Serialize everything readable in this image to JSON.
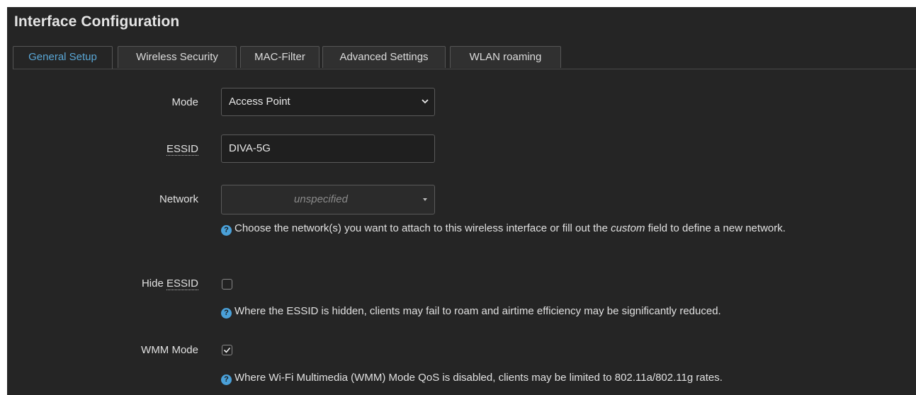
{
  "panel": {
    "title": "Interface Configuration"
  },
  "tabs": [
    {
      "label": "General Setup",
      "active": true
    },
    {
      "label": "Wireless Security",
      "active": false
    },
    {
      "label": "MAC-Filter",
      "active": false
    },
    {
      "label": "Advanced Settings",
      "active": false
    },
    {
      "label": "WLAN roaming",
      "active": false
    }
  ],
  "form": {
    "mode": {
      "label": "Mode",
      "value": "Access Point"
    },
    "essid": {
      "label": "ESSID",
      "value": "DIVA-5G"
    },
    "network": {
      "label": "Network",
      "placeholder": "unspecified",
      "help_before": "Choose the network(s) you want to attach to this wireless interface or fill out the ",
      "help_em": "custom",
      "help_after": " field to define a new network."
    },
    "hide_essid": {
      "label_prefix": "Hide ",
      "label_abbr": "ESSID",
      "checked": false,
      "help": "Where the ESSID is hidden, clients may fail to roam and airtime efficiency may be significantly reduced."
    },
    "wmm_mode": {
      "label": "WMM Mode",
      "checked": true,
      "help": "Where Wi-Fi Multimedia (WMM) Mode QoS is disabled, clients may be limited to 802.11a/802.11g rates."
    }
  },
  "icons": {
    "help": "question-circle-icon",
    "select_chevron": "chevron-down-icon",
    "dropdown_caret": "caret-down-icon",
    "checkmark": "checkmark-icon"
  },
  "colors": {
    "background": "#252525",
    "active_tab_text": "#5aa7d6",
    "help_icon": "#4aa0d8"
  }
}
